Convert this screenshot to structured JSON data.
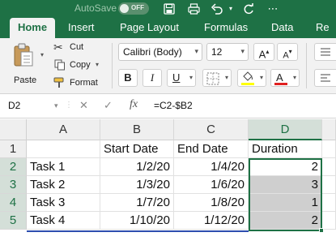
{
  "titlebar": {
    "autosave_label": "AutoSave",
    "autosave_state": "OFF"
  },
  "tabs": [
    {
      "label": "Home"
    },
    {
      "label": "Insert"
    },
    {
      "label": "Page Layout"
    },
    {
      "label": "Formulas"
    },
    {
      "label": "Data"
    },
    {
      "label": "Re"
    }
  ],
  "ribbon": {
    "paste_label": "Paste",
    "cut_label": "Cut",
    "copy_label": "Copy",
    "format_label": "Format",
    "font_name": "Calibri (Body)",
    "font_size": "12",
    "grow_font": "A",
    "shrink_font": "A",
    "bold": "B",
    "italic": "I",
    "underline": "U",
    "font_color_letter": "A"
  },
  "colors": {
    "accent": "#1e7145",
    "highlight": "#ffff00",
    "font_color": "#e02020",
    "selection_fill": "#cfcfcf"
  },
  "formula_bar": {
    "name_box": "D2",
    "fx": "fx",
    "formula": "=C2-$B2"
  },
  "sheet": {
    "columns": [
      "A",
      "B",
      "C",
      "D"
    ],
    "rows": [
      "1",
      "2",
      "3",
      "4",
      "5"
    ],
    "cells": [
      [
        "",
        "Start Date",
        "End Date",
        "Duration"
      ],
      [
        "Task 1",
        "1/2/20",
        "1/4/20",
        "2"
      ],
      [
        "Task 2",
        "1/3/20",
        "1/6/20",
        "3"
      ],
      [
        "Task 3",
        "1/7/20",
        "1/8/20",
        "1"
      ],
      [
        "Task 4",
        "1/10/20",
        "1/12/20",
        "2"
      ]
    ]
  }
}
